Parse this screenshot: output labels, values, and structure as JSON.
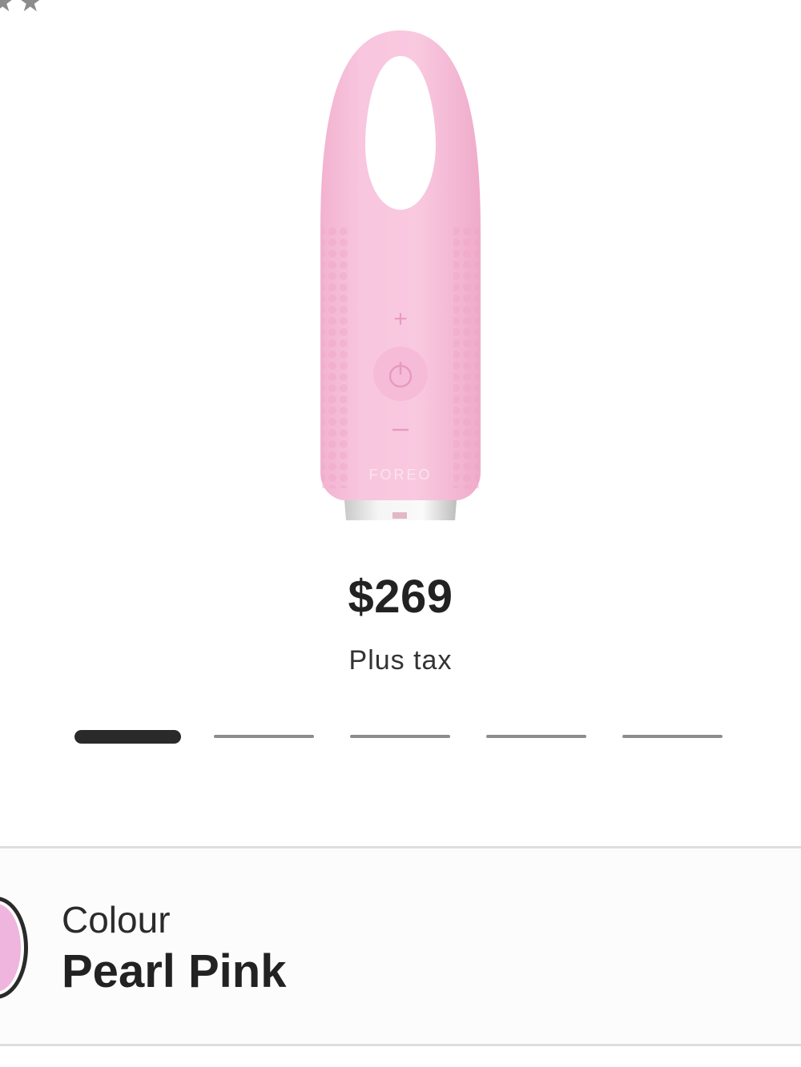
{
  "rating": {
    "stars": [
      "★",
      "★"
    ]
  },
  "product": {
    "brand_mark": "FOREO",
    "body_color": "#f6bfd9",
    "button_plus": "+",
    "button_minus": "−"
  },
  "price": {
    "amount": "$269",
    "note": "Plus tax"
  },
  "carousel": {
    "count": 5,
    "active_index": 0
  },
  "colour": {
    "label": "Colour",
    "value": "Pearl Pink",
    "swatch_color": "#efb5df"
  }
}
